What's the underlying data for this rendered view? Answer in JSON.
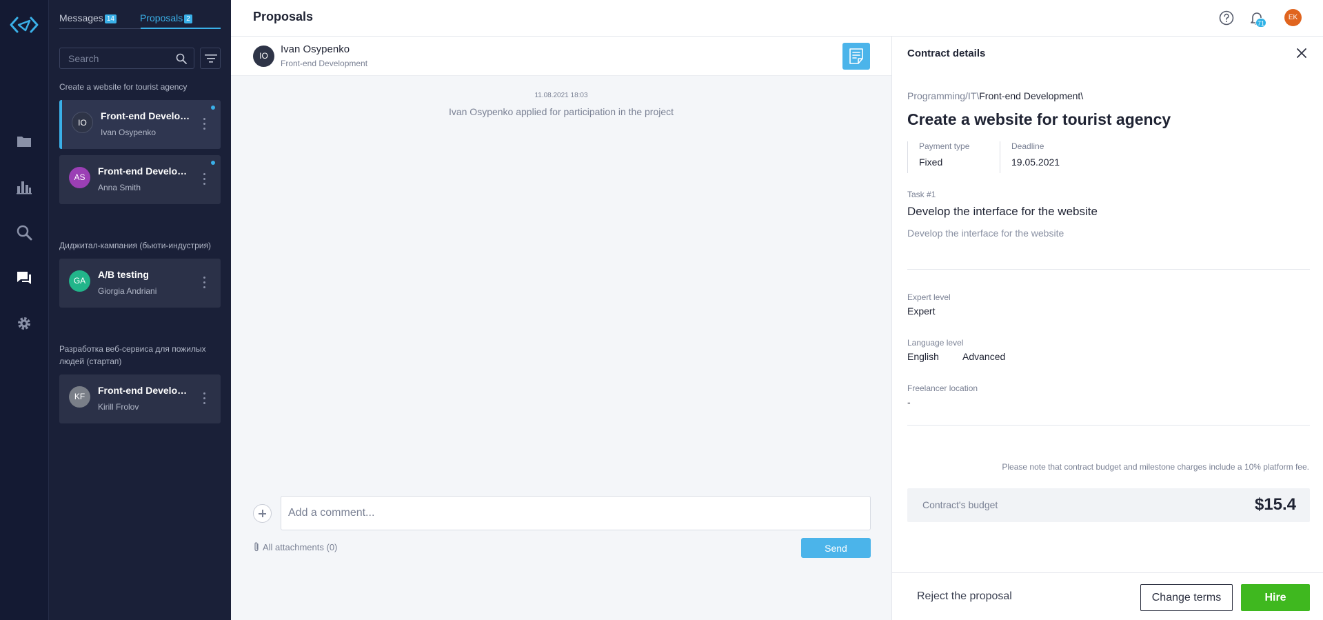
{
  "header": {
    "title": "Proposals",
    "notifications_count": "71",
    "user_initials": "EK"
  },
  "tabs": {
    "messages_label": "Messages",
    "messages_count": "14",
    "proposals_label": "Proposals",
    "proposals_count": "2"
  },
  "search": {
    "placeholder": "Search"
  },
  "groups": [
    {
      "title": "Create a website for tourist agency"
    },
    {
      "title": "Диджитал-кампания (бьюти-индустрия)"
    },
    {
      "title": "Разработка веб-сервиса для пожилых людей (стартап)"
    }
  ],
  "cards": [
    {
      "initials": "IO",
      "title": "Front-end Development",
      "name": "Ivan Osypenko",
      "avatar_color": "#2e3447"
    },
    {
      "initials": "AS",
      "title": "Front-end Development",
      "name": "Anna Smith",
      "avatar_color": "#9b3fb5"
    },
    {
      "initials": "GA",
      "title": "A/B testing",
      "name": "Giorgia Andriani",
      "avatar_color": "#22b58a"
    },
    {
      "initials": "KF",
      "title": "Front-end Development",
      "name": "Kirill Frolov",
      "avatar_color": "#7a7f88"
    }
  ],
  "chat": {
    "initials": "IO",
    "name": "Ivan Osypenko",
    "role": "Front-end Development",
    "message_time": "11.08.2021 18:03",
    "message_text": "Ivan Osypenko applied for participation in the project",
    "comment_placeholder": "Add a comment...",
    "attachments_label": "All attachments (0)",
    "send_label": "Send"
  },
  "contract": {
    "title": "Contract details",
    "breadcrumb_parent": "Programming/IT\\",
    "breadcrumb_current": "Front-end Development\\",
    "project_title": "Create a website for tourist agency",
    "payment_type_label": "Payment type",
    "payment_type_value": "Fixed",
    "deadline_label": "Deadline",
    "deadline_value": "19.05.2021",
    "task_number": "Task #1",
    "task_title": "Develop the interface for the website",
    "task_description": "Develop the interface for the website",
    "expert_level_label": "Expert level",
    "expert_level_value": "Expert",
    "language_level_label": "Language level",
    "language_value": "English",
    "language_level_value": "Advanced",
    "location_label": "Freelancer location",
    "location_value": "-",
    "fee_note": "Please note that contract budget and milestone charges include a 10% platform fee.",
    "budget_label": "Contract's budget",
    "budget_value": "$15.4",
    "reject_label": "Reject the proposal",
    "change_terms_label": "Change terms",
    "hire_label": "Hire"
  },
  "colors": {
    "accent": "#3ab0e8",
    "hire": "#3fb81f",
    "sidebar": "#141a33",
    "panel": "#1a2038"
  },
  "icons": [
    "logo-icon",
    "folder-icon",
    "chart-icon",
    "search-icon",
    "chat-icon",
    "gear-icon",
    "help-icon",
    "bell-icon",
    "filter-icon",
    "document-icon",
    "close-icon",
    "paperclip-icon",
    "plus-icon",
    "kebab-icon"
  ]
}
